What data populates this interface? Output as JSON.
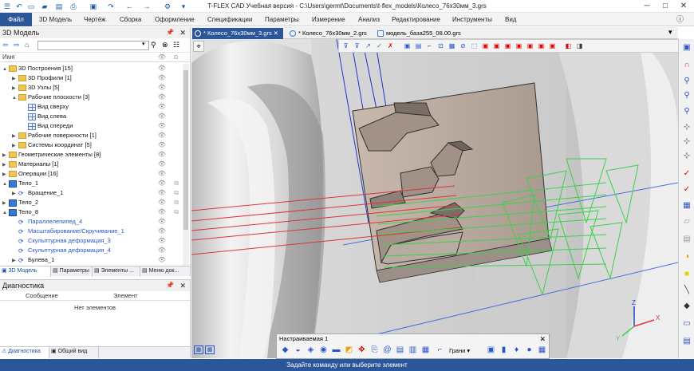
{
  "title": "T-FLEX CAD Учебная версия - C:\\Users\\germt\\Documents\\t-flex_models\\Колесо_76х30мм_3.grs",
  "menu": [
    "Файл",
    "3D Модель",
    "Чертёж",
    "Сборка",
    "Оформление",
    "Спецификации",
    "Параметры",
    "Измерение",
    "Анализ",
    "Редактирование",
    "Инструменты",
    "Вид"
  ],
  "left_panel": {
    "title": "3D Модель",
    "column_name": "Имя",
    "tree": [
      {
        "label": "3D Построения [15]",
        "level": 0,
        "icon": "folder-icon",
        "toggle": "▲",
        "blue": false
      },
      {
        "label": "3D Профили [1]",
        "level": 1,
        "icon": "folder-icon",
        "toggle": "▶",
        "blue": false
      },
      {
        "label": "3D Узлы [5]",
        "level": 1,
        "icon": "folder-icon",
        "toggle": "▶",
        "blue": false
      },
      {
        "label": "Рабочие плоскости [3]",
        "level": 1,
        "icon": "folder-icon",
        "toggle": "▲",
        "blue": false
      },
      {
        "label": "Вид сверху",
        "level": 2,
        "icon": "plane-icon",
        "toggle": "",
        "blue": false
      },
      {
        "label": "Вид слева",
        "level": 2,
        "icon": "plane-icon",
        "toggle": "",
        "blue": false
      },
      {
        "label": "Вид спереди",
        "level": 2,
        "icon": "plane-icon",
        "toggle": "",
        "blue": false
      },
      {
        "label": "Рабочие поверхности [1]",
        "level": 1,
        "icon": "folder-icon",
        "toggle": "▶",
        "blue": false
      },
      {
        "label": "Системы координат [5]",
        "level": 1,
        "icon": "folder-icon",
        "toggle": "▶",
        "blue": false
      },
      {
        "label": "Геометрические элементы [8]",
        "level": 0,
        "icon": "folder-icon",
        "toggle": "▶",
        "blue": false
      },
      {
        "label": "Материалы [1]",
        "level": 0,
        "icon": "folder-icon",
        "toggle": "▶",
        "blue": false
      },
      {
        "label": "Операции [16]",
        "level": 0,
        "icon": "folder-icon",
        "toggle": "▶",
        "blue": false
      },
      {
        "label": "Тело_1",
        "level": 0,
        "icon": "body-icon",
        "toggle": "▲",
        "blue": false
      },
      {
        "label": "Вращение_1",
        "level": 1,
        "icon": "operation-icon",
        "toggle": "▶",
        "blue": false
      },
      {
        "label": "Тело_2",
        "level": 0,
        "icon": "body-icon",
        "toggle": "▶",
        "blue": false
      },
      {
        "label": "Тело_8",
        "level": 0,
        "icon": "body-icon",
        "toggle": "▲",
        "blue": false
      },
      {
        "label": "Параллелепипед_4",
        "level": 1,
        "icon": "operation-icon",
        "toggle": "",
        "blue": true
      },
      {
        "label": "Масштабирование/Скручивание_1",
        "level": 1,
        "icon": "operation-icon",
        "toggle": "",
        "blue": true
      },
      {
        "label": "Скульптурная деформация_3",
        "level": 1,
        "icon": "operation-icon",
        "toggle": "",
        "blue": true
      },
      {
        "label": "Скульптурная деформация_4",
        "level": 1,
        "icon": "operation-icon",
        "toggle": "",
        "blue": true
      },
      {
        "label": "Булева_1",
        "level": 1,
        "icon": "operation-icon",
        "toggle": "▶",
        "blue": false
      }
    ],
    "tabs": [
      "3D Модель",
      "Параметры",
      "Элементы ...",
      "Меню док..."
    ]
  },
  "diagnostics": {
    "title": "Диагностика",
    "col_message": "Сообщение",
    "col_element": "Элемент",
    "empty": "Нет элементов",
    "tabs": [
      "Диагностика",
      "Общий вид"
    ]
  },
  "doc_tabs": [
    "* Колесо_76х30мм_3.grs",
    "* Колесо_76х30мм_2.grs",
    "модель_база255_08.00.grs"
  ],
  "float_toolbar": {
    "title": "Настраиваемая 1",
    "faces_label": "Грани"
  },
  "status_text": "Задайте команду или выберите элемент",
  "axes": {
    "x": "X",
    "y": "Y",
    "z": "Z"
  },
  "colors": {
    "accent": "#2b579a",
    "tree_link": "#2a55c8",
    "red_lines": "#e0333a",
    "green_lines": "#3dd14a",
    "blue_lines": "#2233cc"
  }
}
